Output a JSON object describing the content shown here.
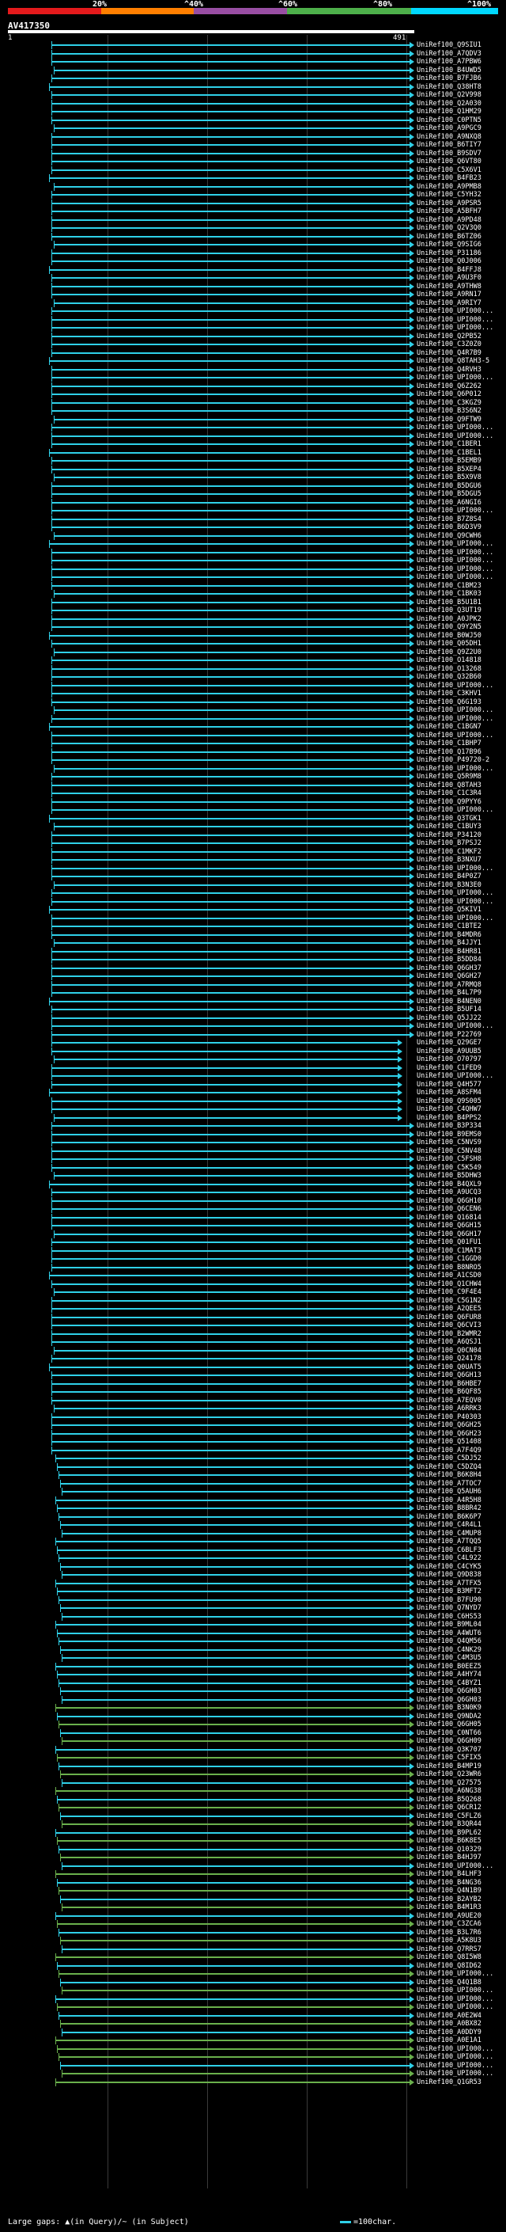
{
  "colors": {
    "red": "#e41a1c",
    "orange": "#ff7f00",
    "purple": "#984ea3",
    "green": "#4daf4a",
    "cyan": "#00d8ff",
    "bar_cyan": "#2fd0e8",
    "bar_green": "#6ab04c",
    "grid": "#3a3a3a"
  },
  "scale": {
    "labels": [
      "20%",
      "^40%",
      "^60%",
      "^80%",
      "^100%"
    ]
  },
  "query": {
    "id": "AV417350",
    "start": "1",
    "end": "491"
  },
  "hits": [
    "UniRef100_Q9SIU1",
    "UniRef100_A7QDV3",
    "UniRef100_A7PBW6",
    "UniRef100_B4UWD5",
    "UniRef100_B7FJB6",
    "UniRef100_Q38HT8",
    "UniRef100_Q2V998",
    "UniRef100_Q2A030",
    "UniRef100_Q1HM29",
    "UniRef100_C0PTN5",
    "UniRef100_A9PGC9",
    "UniRef100_A9NXQ8",
    "UniRef100_B6TIY7",
    "UniRef100_B9SDV7",
    "UniRef100_Q6VT80",
    "UniRef100_C5X6V1",
    "UniRef100_B4FB23",
    "UniRef100_A9PMB8",
    "UniRef100_C5YH32",
    "UniRef100_A9PSR5",
    "UniRef100_A5BFH7",
    "UniRef100_A9PD48",
    "UniRef100_Q2V3Q0",
    "UniRef100_B6TZ06",
    "UniRef100_Q9SIG6",
    "UniRef100_P31186",
    "UniRef100_Q0J006",
    "UniRef100_B4FFJ8",
    "UniRef100_A9U3F0",
    "UniRef100_A9THW8",
    "UniRef100_A9RN17",
    "UniRef100_A9RIY7",
    "UniRef100_UPI000...",
    "UniRef100_UPI000...",
    "UniRef100_UPI000...",
    "UniRef100_Q2PB52",
    "UniRef100_C3Z0Z0",
    "UniRef100_Q4R7B9",
    "UniRef100_Q8TAH3-5",
    "UniRef100_Q4RVH3",
    "UniRef100_UPI000...",
    "UniRef100_Q6Z262",
    "UniRef100_Q6P012",
    "UniRef100_C3KGZ9",
    "UniRef100_B3S6N2",
    "UniRef100_Q9FTW9",
    "UniRef100_UPI000...",
    "UniRef100_UPI000...",
    "UniRef100_C1BER1",
    "UniRef100_C1BEL1",
    "UniRef100_B5EMB9",
    "UniRef100_B5XEP4",
    "UniRef100_B5X9V8",
    "UniRef100_B5DGU6",
    "UniRef100_B5DGU5",
    "UniRef100_A6NGI6",
    "UniRef100_UPI000...",
    "UniRef100_B7Z8S4",
    "UniRef100_B6D3V9",
    "UniRef100_Q9CWH6",
    "UniRef100_UPI000...",
    "UniRef100_UPI000...",
    "UniRef100_UPI000...",
    "UniRef100_UPI000...",
    "UniRef100_UPI000...",
    "UniRef100_C1BM23",
    "UniRef100_C1BK03",
    "UniRef100_B5U1B1",
    "UniRef100_Q3UT19",
    "UniRef100_A0JPK2",
    "UniRef100_Q9Y2N5",
    "UniRef100_B0WJ50",
    "UniRef100_Q05DH1",
    "UniRef100_Q9Z2U0",
    "UniRef100_O14818",
    "UniRef100_O13268",
    "UniRef100_Q32B60",
    "UniRef100_UPI000...",
    "UniRef100_C3KHV1",
    "UniRef100_Q6G193",
    "UniRef100_UPI000...",
    "UniRef100_UPI000...",
    "UniRef100_C1BGN7",
    "UniRef100_UPI000...",
    "UniRef100_C1BHP7",
    "UniRef100_Q17B96",
    "UniRef100_P49720-2",
    "UniRef100_UPI000...",
    "UniRef100_Q5R9M8",
    "UniRef100_Q8TAH3",
    "UniRef100_C1C3R4",
    "UniRef100_Q9PYY6",
    "UniRef100_UPI000...",
    "UniRef100_Q3TGK1",
    "UniRef100_C1BUY3",
    "UniRef100_P34120",
    "UniRef100_B7PSJ2",
    "UniRef100_C1MKF2",
    "UniRef100_B3NXU7",
    "UniRef100_UPI000...",
    "UniRef100_B4P0Z7",
    "UniRef100_B3N3E0",
    "UniRef100_UPI000...",
    "UniRef100_UPI000...",
    "UniRef100_Q5KIV1",
    "UniRef100_UPI000...",
    "UniRef100_C1BTE2",
    "UniRef100_B4MDR6",
    "UniRef100_B4JJY1",
    "UniRef100_B4HR81",
    "UniRef100_B5DD84",
    "UniRef100_Q6GH37",
    "UniRef100_Q6GH27",
    "UniRef100_A7RMQ8",
    "UniRef100_B4L7P9",
    "UniRef100_B4NEN0",
    "UniRef100_B5UF14",
    "UniRef100_Q5JJ22",
    "UniRef100_UPI000...",
    "UniRef100_P22769",
    "UniRef100_Q29GE7",
    "UniRef100_A9UUB5",
    "UniRef100_O70797",
    "UniRef100_C1FED9",
    "UniRef100_UPI000...",
    "UniRef100_Q4H577",
    "UniRef100_A8SFM4",
    "UniRef100_Q9S005",
    "UniRef100_C4QHW7",
    "UniRef100_B4PPS2",
    "UniRef100_B3P334",
    "UniRef100_B9EMS0",
    "UniRef100_C5NVS9",
    "UniRef100_C5NV48",
    "UniRef100_C5FSH8",
    "UniRef100_C5K549",
    "UniRef100_B5DHW3",
    "UniRef100_B4QXL9",
    "UniRef100_A9UCQ3",
    "UniRef100_Q6GH10",
    "UniRef100_Q6CEN6",
    "UniRef100_Q16814",
    "UniRef100_Q6GH15",
    "UniRef100_Q6GH17",
    "UniRef100_Q01FU1",
    "UniRef100_C1MAT3",
    "UniRef100_C1GGD0",
    "UniRef100_B8NRO5",
    "UniRef100_A1CSD0",
    "UniRef100_Q1CHW4",
    "UniRef100_C9F4E4",
    "UniRef100_C5G1N2",
    "UniRef100_A2QEE5",
    "UniRef100_Q6FUR8",
    "UniRef100_Q6CVI3",
    "UniRef100_B2WMR2",
    "UniRef100_A6QSJ1",
    "UniRef100_Q0CN04",
    "UniRef100_Q24178",
    "UniRef100_Q0UAT5",
    "UniRef100_Q6GH13",
    "UniRef100_B6HBE7",
    "UniRef100_B6QF85",
    "UniRef100_A7EQV0",
    "UniRef100_A6RRK3",
    "UniRef100_P40303",
    "UniRef100_Q6GH25",
    "UniRef100_Q6GH23",
    "UniRef100_Q51408",
    "UniRef100_A7F4Q9",
    "UniRef100_C5DJ52",
    "UniRef100_C5DZQ4",
    "UniRef100_B6K8H4",
    "UniRef100_A7TOC7",
    "UniRef100_Q5AUH6",
    "UniRef100_A4R5H8",
    "UniRef100_B8BR42",
    "UniRef100_B6K6P7",
    "UniRef100_C4R4L1",
    "UniRef100_C4MUP8",
    "UniRef100_A7TQQ5",
    "UniRef100_C6BLF3",
    "UniRef100_C4L922",
    "UniRef100_C4CYK5",
    "UniRef100_Q9D838",
    "UniRef100_A7TFX5",
    "UniRef100_B3MFT2",
    "UniRef100_B7FU90",
    "UniRef100_Q7NYD7",
    "UniRef100_C6HS53",
    "UniRef100_B9ML04",
    "UniRef100_A4WUT6",
    "UniRef100_Q4QM56",
    "UniRef100_C4NK29",
    "UniRef100_C4M3U5",
    "UniRef100_B0EEZ5",
    "UniRef100_A4HY74",
    "UniRef100_C4BYZ1",
    "UniRef100_Q6GH03",
    "UniRef100_Q6GH03",
    "UniRef100_B3N0K9",
    "UniRef100_Q9NDA2",
    "UniRef100_Q6GH05",
    "UniRef100_C0NT66",
    "UniRef100_Q6GH09",
    "UniRef100_Q3K707",
    "UniRef100_C5FIX5",
    "UniRef100_B4MP19",
    "UniRef100_Q23WR6",
    "UniRef100_Q27575",
    "UniRef100_A6NG38",
    "UniRef100_B5Q268",
    "UniRef100_Q6CR12",
    "UniRef100_C5FLZ6",
    "UniRef100_B3QR44",
    "UniRef100_B9PL62",
    "UniRef100_B6K8E5",
    "UniRef100_Q10329",
    "UniRef100_B4HJ97",
    "UniRef100_UPI000...",
    "UniRef100_B4LHF3",
    "UniRef100_B4NG36",
    "UniRef100_Q4N1B9",
    "UniRef100_B2AYB2",
    "UniRef100_B4M1R3",
    "UniRef100_A9UE20",
    "UniRef100_C3ZCA6",
    "UniRef100_B3L7R6",
    "UniRef100_A5K8U3",
    "UniRef100_Q7RRS7",
    "UniRef100_Q8I5W8",
    "UniRef100_Q8ID62",
    "UniRef100_UPI000...",
    "UniRef100_Q4Q1B8",
    "UniRef100_UPI000...",
    "UniRef100_UPI000...",
    "UniRef100_UPI000...",
    "UniRef100_A0E2W4",
    "UniRef100_A0BX82",
    "UniRef100_A0DDY9",
    "UniRef100_A0E1A1",
    "UniRef100_UPI000...",
    "UniRef100_UPI000...",
    "UniRef100_UPI000...",
    "UniRef100_UPI000...",
    "UniRef100_Q1GR53"
  ],
  "footer": {
    "left_label": "Large gaps:",
    "left_legend": "▲(in Query)/~ (in Subject)",
    "right_label": "=100char."
  }
}
